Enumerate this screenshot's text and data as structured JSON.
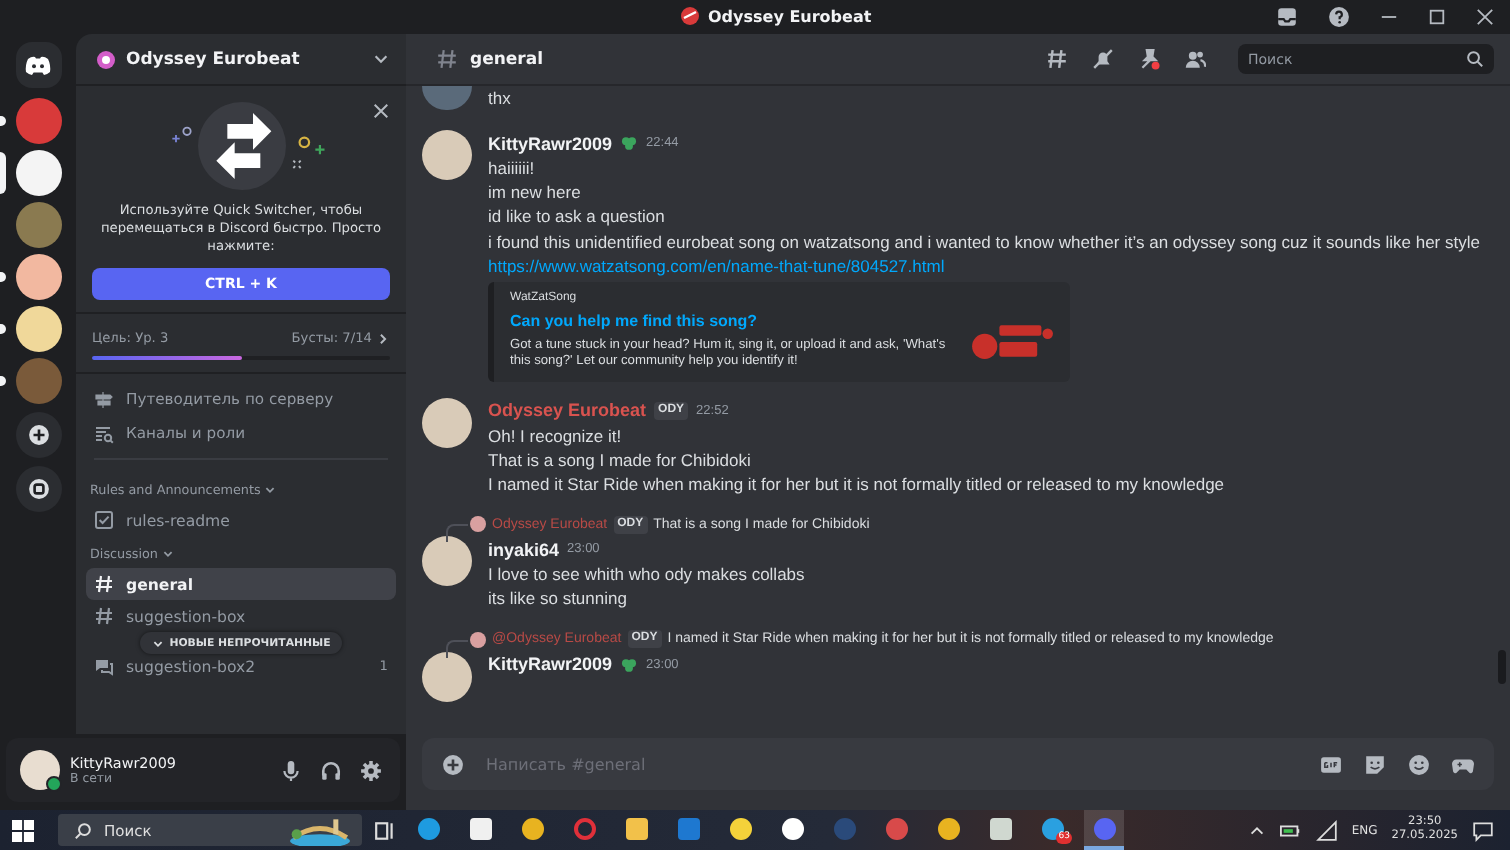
{
  "window": {
    "title": "Odyssey Eurobeat"
  },
  "servers": [
    {
      "color": "#d83a3a",
      "selected": false,
      "unread": true
    },
    {
      "color": "#f4f4f4",
      "selected": true,
      "unread": false
    },
    {
      "color": "#8a7a50",
      "selected": false,
      "unread": false
    },
    {
      "color": "#f2b8a0",
      "selected": false,
      "unread": true
    },
    {
      "color": "#f0d89a",
      "selected": false,
      "unread": true
    },
    {
      "color": "#7a5a3a",
      "selected": false,
      "unread": true
    }
  ],
  "server": {
    "name": "Odyssey Eurobeat"
  },
  "quick_switcher": {
    "text": "Используйте Quick Switcher, чтобы перемещаться в Discord быстро. Просто нажмите:",
    "button": "CTRL + K"
  },
  "boost": {
    "goal": "Цель: Ур. 3",
    "count": "Бусты: 7/14",
    "level": 0.5
  },
  "nav": [
    {
      "kind": "guide",
      "label": "Путеводитель по серверу"
    },
    {
      "kind": "roles",
      "label": "Каналы и роли"
    }
  ],
  "categories": [
    {
      "name": "Rules and Announcements",
      "channels": [
        {
          "kind": "rules",
          "name": "rules-readme",
          "selected": false
        }
      ]
    },
    {
      "name": "Discussion",
      "channels": [
        {
          "kind": "text",
          "name": "general",
          "selected": true
        },
        {
          "kind": "text",
          "name": "suggestion-box",
          "selected": false
        },
        {
          "kind": "forum",
          "name": "suggestion-box2",
          "selected": false,
          "badge": "1"
        }
      ]
    }
  ],
  "unread_pill": "НОВЫЕ НЕПРОЧИТАННЫЕ",
  "user": {
    "name": "KittyRawr2009",
    "status": "В сети"
  },
  "channel": {
    "name": "general",
    "search_placeholder": "Поиск"
  },
  "messages": [
    {
      "kind": "continuation",
      "lines": [
        "thx"
      ]
    },
    {
      "kind": "message",
      "author": "KittyRawr2009",
      "color": "#f2f3f5",
      "guild_badge": true,
      "time": "22:44",
      "lines": [
        "haiiiiii!",
        "im new here",
        "id like to ask a question",
        "i found this unidentified eurobeat song on watzatsong and i wanted to know whether it’s an odyssey song cuz it sounds like her style"
      ],
      "link": "https://www.watzatsong.com/en/name-that-tune/804527.html",
      "embed": {
        "site": "WatZatSong",
        "title": "Can you help me find this song?",
        "description": "Got a tune stuck in your head? Hum it, sing it, or upload it and ask, 'What's this song?' Let our community help you identify it!"
      }
    },
    {
      "kind": "message",
      "author": "Odyssey Eurobeat",
      "color": "#d9534f",
      "tag": "ODY",
      "time": "22:52",
      "lines": [
        "Oh! I recognize it!",
        "That is a song I made for Chibidoki",
        "I named it Star Ride when making it for her but it is not formally titled or released to my knowledge"
      ]
    },
    {
      "kind": "message",
      "reply": {
        "author": "Odyssey Eurobeat",
        "tag": "ODY",
        "text": "That is a song I made for Chibidoki"
      },
      "author": "inyaki64",
      "color": "#f2f3f5",
      "time": "23:00",
      "lines": [
        "I love to see whith who ody makes collabs",
        "its like so stunning"
      ]
    },
    {
      "kind": "message",
      "reply": {
        "author": "@Odyssey Eurobeat",
        "tag": "ODY",
        "text": "I named it Star Ride when making it for her but it is not formally titled or released to my knowledge"
      },
      "author": "KittyRawr2009",
      "color": "#f2f3f5",
      "guild_badge": true,
      "time": "23:00"
    }
  ],
  "composer": {
    "placeholder": "Написать #general"
  },
  "taskbar": {
    "search": "Поиск",
    "apps": [
      {
        "kind": "circle",
        "color": "#1e9be0",
        "selected": false
      },
      {
        "kind": "square",
        "color": "#f0f0f0",
        "selected": false
      },
      {
        "kind": "circle",
        "color": "#e8b320",
        "selected": false
      },
      {
        "kind": "ring",
        "color": "#e0303a",
        "selected": false
      },
      {
        "kind": "square",
        "color": "#f2c14a",
        "selected": false
      },
      {
        "kind": "square",
        "color": "#1e78d0",
        "selected": false
      },
      {
        "kind": "circle",
        "color": "#f4d23a",
        "selected": false
      },
      {
        "kind": "circle",
        "color": "#ffffff",
        "selected": false
      },
      {
        "kind": "circle",
        "color": "#2a4a7a",
        "selected": false
      },
      {
        "kind": "circle",
        "color": "#d84a4a",
        "selected": false
      },
      {
        "kind": "circle",
        "color": "#e8b320",
        "selected": false
      },
      {
        "kind": "square",
        "color": "#d0d8d0",
        "selected": false
      },
      {
        "kind": "circle",
        "color": "#2aa0e0",
        "selected": false,
        "badge": "63"
      },
      {
        "kind": "circle",
        "color": "#5865f2",
        "selected": true
      }
    ],
    "lang": "ENG",
    "time": "23:50",
    "date": "27.05.2025"
  }
}
